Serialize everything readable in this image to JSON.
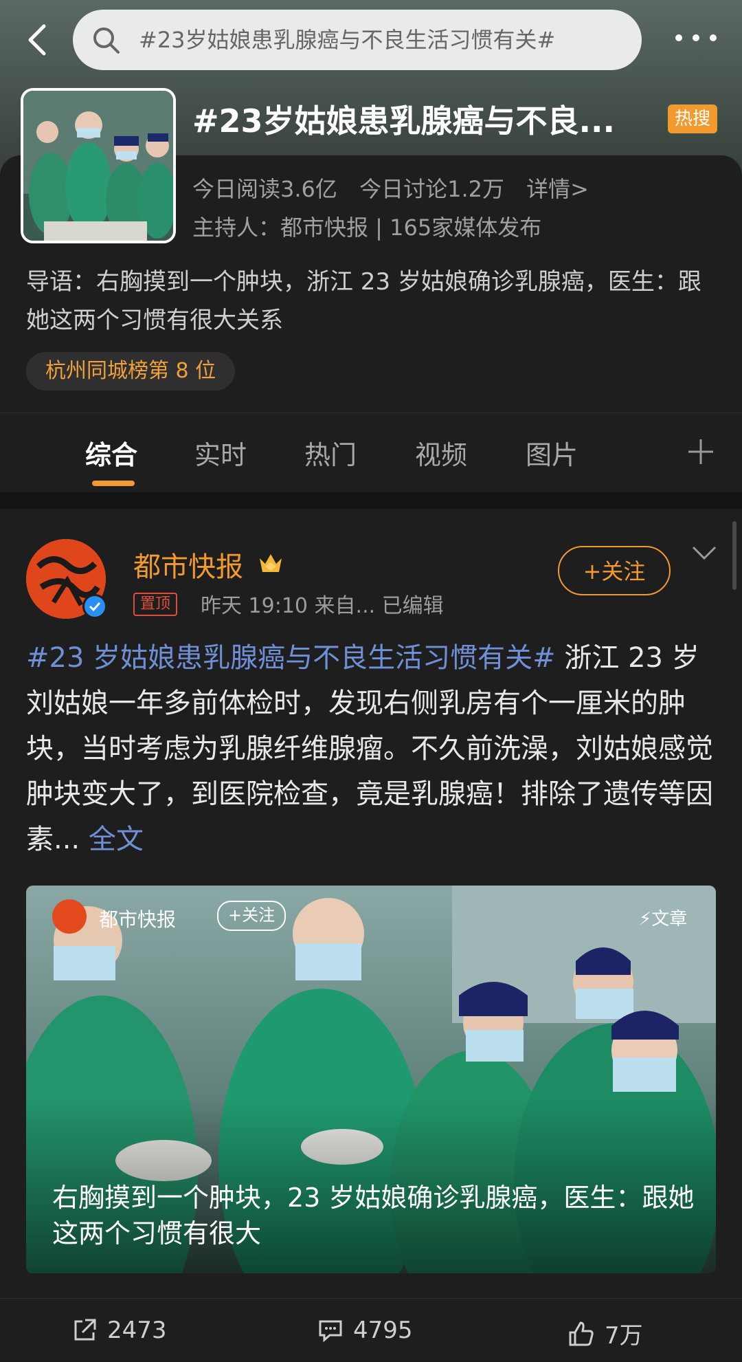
{
  "search": {
    "query": "#23岁姑娘患乳腺癌与不良生活习惯有关#"
  },
  "topic": {
    "title": "#23岁姑娘患乳腺癌与不良...",
    "badge": "热搜",
    "reads": "今日阅读3.6亿",
    "discuss": "今日讨论1.2万",
    "details": "详情>",
    "host": "主持人：都市快报 | 165家媒体发布",
    "intro": "导语：右胸摸到一个肿块，浙江 23 岁姑娘确诊乳腺癌，医生：跟她这两个习惯有很大关系",
    "rank": "杭州同城榜第 8 位"
  },
  "tabs": [
    "综合",
    "实时",
    "热门",
    "视频",
    "图片"
  ],
  "post": {
    "author": "都市快报",
    "pinned": "置顶",
    "meta": "昨天 19:10  来自...  已编辑",
    "follow": "+关注",
    "hashtag": "#23 岁姑娘患乳腺癌与不良生活习惯有关#",
    "body": " 浙江 23 岁刘姑娘一年多前体检时，发现右侧乳房有个一厘米的肿块，当时考虑为乳腺纤维腺瘤。不久前洗澡，刘姑娘感觉肿块变大了，到医院检查，竟是乳腺癌！排除了遗传等因素...",
    "more": "全文",
    "media": {
      "author": "都市快报",
      "follow": "+关注",
      "kind": "文章",
      "caption": "右胸摸到一个肿块，23 岁姑娘确诊乳腺癌，医生：跟她这两个习惯有很大"
    },
    "shares": "2473",
    "comments": "4795",
    "likes": "7万"
  },
  "colors": {
    "accent": "#f39a2f",
    "link": "#6f8fd6",
    "pinned": "#e04f3c"
  }
}
